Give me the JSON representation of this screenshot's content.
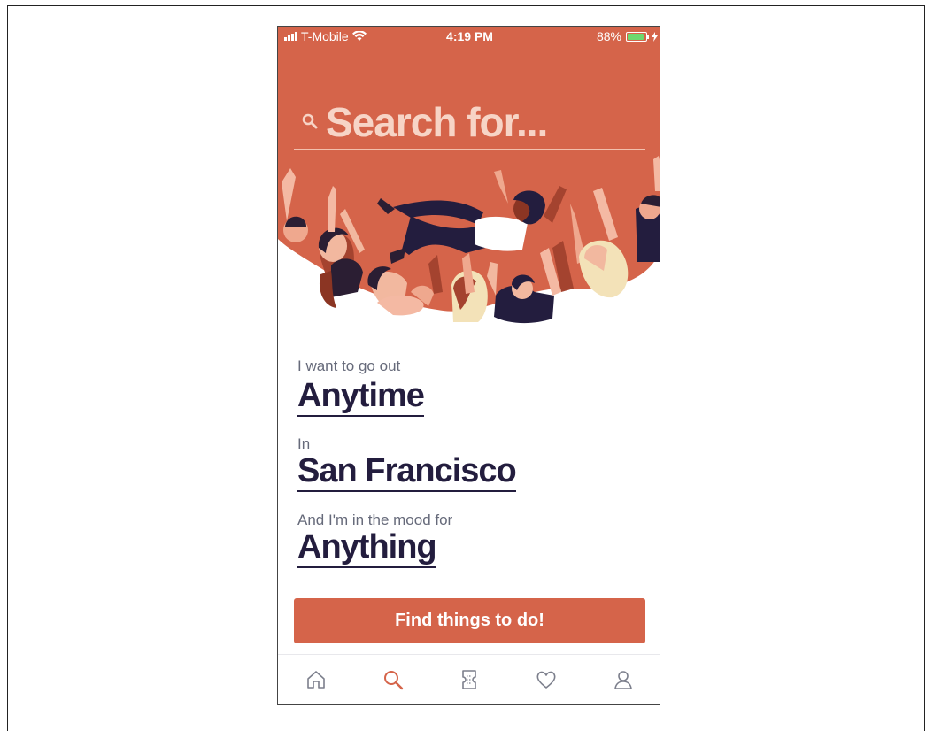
{
  "status_bar": {
    "carrier": "T-Mobile",
    "time": "4:19 PM",
    "battery_percent": "88%",
    "battery_level": 0.88,
    "wifi_icon": "wifi-icon",
    "charging_icon": "bolt-icon"
  },
  "search": {
    "placeholder": "Search for..."
  },
  "prompts": {
    "when": {
      "label": "I want to go out",
      "value": "Anytime"
    },
    "where": {
      "label": "In",
      "value": "San Francisco"
    },
    "mood": {
      "label": "And I'm in the mood for",
      "value": "Anything"
    }
  },
  "cta": {
    "label": "Find things to do!"
  },
  "tab_bar": {
    "active": "search",
    "items": [
      {
        "icon": "home-icon"
      },
      {
        "icon": "search-icon"
      },
      {
        "icon": "ticket-icon"
      },
      {
        "icon": "heart-icon"
      },
      {
        "icon": "profile-icon"
      }
    ]
  },
  "colors": {
    "brand": "#d5644a",
    "ink": "#231d3e",
    "muted": "#666a7a",
    "search_text": "#f7d4c6",
    "tab_inactive": "#7c7f8c"
  }
}
